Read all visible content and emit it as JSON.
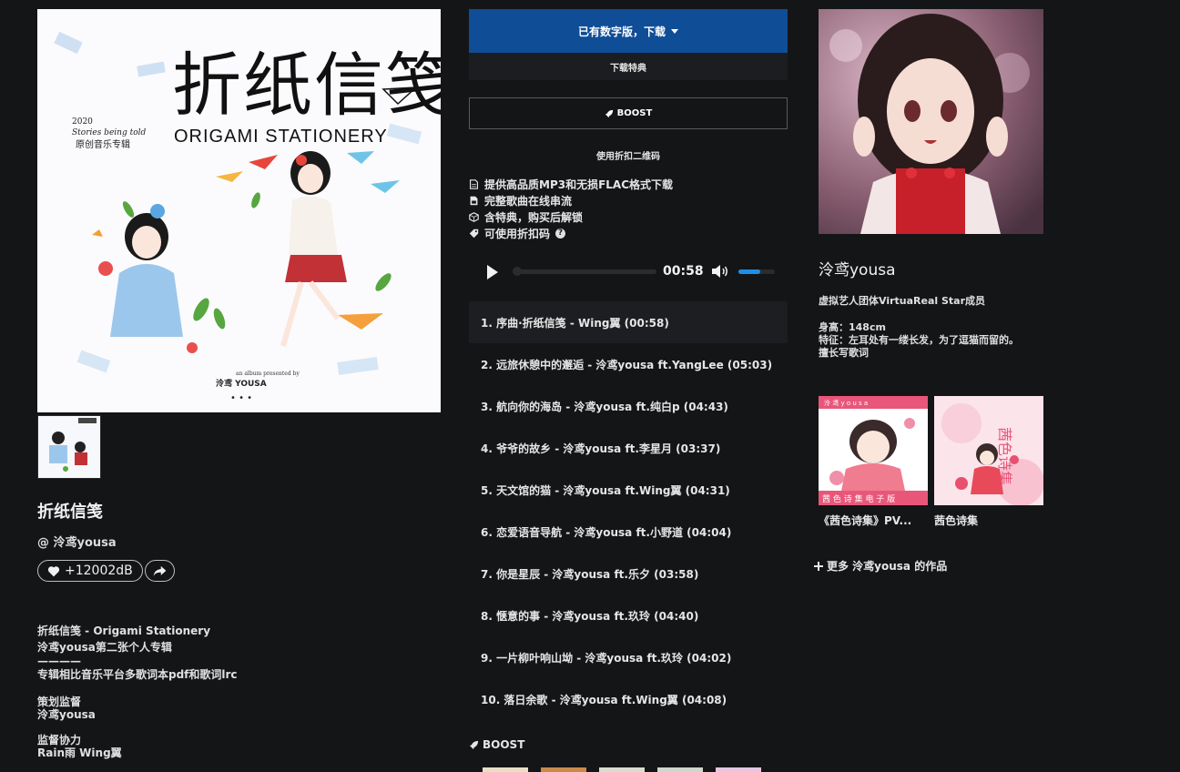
{
  "album": {
    "cover_art": {
      "title_cn": "折纸信笺",
      "title_en": "ORIGAMI STATIONERY",
      "year": "2020",
      "tagline": "Stories being told",
      "subtitle": "原创音乐专辑",
      "presented_by": "an album presented by",
      "artist_mark": "泠鸢 YOUSA"
    },
    "title": "折纸信笺",
    "artist": "@ 泠鸢yousa",
    "likes": "+12002dB",
    "description": [
      "折纸信笺 - Origami Stationery",
      "泠鸢yousa第二张个人专辑",
      "————",
      "专辑相比音乐平台多歌词本pdf和歌词lrc"
    ],
    "credits": [
      {
        "role": "策划监督",
        "names": "泠鸢yousa"
      },
      {
        "role": "监督协力",
        "names": "Rain雨 Wing翼"
      }
    ]
  },
  "purchase": {
    "buy_label": "已有数字版，下载",
    "bonus_label": "下载特典",
    "boost_label": "BOOST",
    "discount_label": "使用折扣二维码",
    "features": [
      {
        "icon": "file-icon",
        "text": "提供高品质MP3和无损FLAC格式下载"
      },
      {
        "icon": "stream-icon",
        "text": "完整歌曲在线串流"
      },
      {
        "icon": "package-icon",
        "text": "含特典，购买后解锁"
      },
      {
        "icon": "tag-icon",
        "text": "可使用折扣码"
      }
    ]
  },
  "player": {
    "time": "00:58",
    "progress": 0.0,
    "volume": 0.6
  },
  "tracks": [
    "1. 序曲·折纸信笺 - Wing翼 (00:58)",
    "2. 远旅休憩中的邂逅 - 泠鸢yousa ft.YangLee (05:03)",
    "3. 航向你的海岛 - 泠鸢yousa ft.纯白p (04:43)",
    "4. 爷爷的故乡 - 泠鸢yousa ft.李星月 (03:37)",
    "5. 天文馆的猫 - 泠鸢yousa ft.Wing翼 (04:31)",
    "6. 恋爱语音导航 - 泠鸢yousa ft.小野道 (04:04)",
    "7. 你是星辰 - 泠鸢yousa ft.乐夕 (03:58)",
    "8. 惬意的事 - 泠鸢yousa ft.玖玲 (04:40)",
    "9. 一片柳叶响山坳 - 泠鸢yousa ft.玖玲 (04:02)",
    "10. 落日余歌 - 泠鸢yousa ft.Wing翼 (04:08)"
  ],
  "boost_section": {
    "heading": "BOOST"
  },
  "artist": {
    "name": "泠鸢yousa",
    "bio": [
      "虚拟艺人团体VirtuaReal Star成员",
      "身高：148cm",
      "特征：左耳处有一缕长发，为了逗猫而留的。",
      "擅长写歌词"
    ],
    "related": [
      {
        "title": "《茜色诗集》PV...",
        "cover_text": "茜 色 诗 集 电 子 版",
        "cover_top": "泠 鸢 y o u s a"
      },
      {
        "title": "茜色诗集",
        "cover_text": "茜色诗集"
      }
    ],
    "more_label": "更多 泠鸢yousa 的作品"
  },
  "colors": {
    "background": "#141517",
    "buy_button": "#0f4d97",
    "active_track": "#1d1e21",
    "volume_fill": "#1e8fe8"
  }
}
